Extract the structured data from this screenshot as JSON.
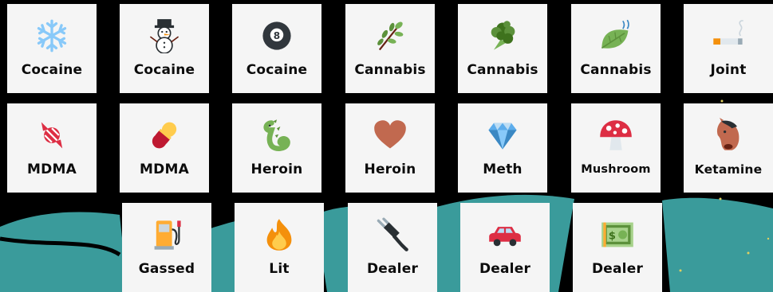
{
  "accent_color": "#3a9b9b",
  "background_color": "#000000",
  "cards": [
    {
      "label": "Cocaine",
      "icon": "snowflake-icon"
    },
    {
      "label": "Cocaine",
      "icon": "snowman-icon"
    },
    {
      "label": "Cocaine",
      "icon": "eight-ball-icon"
    },
    {
      "label": "Cannabis",
      "icon": "herb-icon"
    },
    {
      "label": "Cannabis",
      "icon": "broccoli-icon"
    },
    {
      "label": "Cannabis",
      "icon": "leaf-fluttering-in-wind-icon"
    },
    {
      "label": "Joint",
      "icon": "cigarette-icon"
    },
    {
      "label": "MDMA",
      "icon": "candy-icon"
    },
    {
      "label": "MDMA",
      "icon": "pill-icon"
    },
    {
      "label": "Heroin",
      "icon": "dragon-icon"
    },
    {
      "label": "Heroin",
      "icon": "brown-heart-icon"
    },
    {
      "label": "Meth",
      "icon": "gem-icon"
    },
    {
      "label": "Mushroom",
      "icon": "mushroom-icon"
    },
    {
      "label": "Ketamine",
      "icon": "horse-face-icon"
    },
    {
      "label": "Gassed",
      "icon": "fuel-pump-icon"
    },
    {
      "label": "Lit",
      "icon": "fire-icon"
    },
    {
      "label": "Dealer",
      "icon": "electric-plug-icon"
    },
    {
      "label": "Dealer",
      "icon": "red-car-icon"
    },
    {
      "label": "Dealer",
      "icon": "dollar-banknote-icon"
    }
  ]
}
